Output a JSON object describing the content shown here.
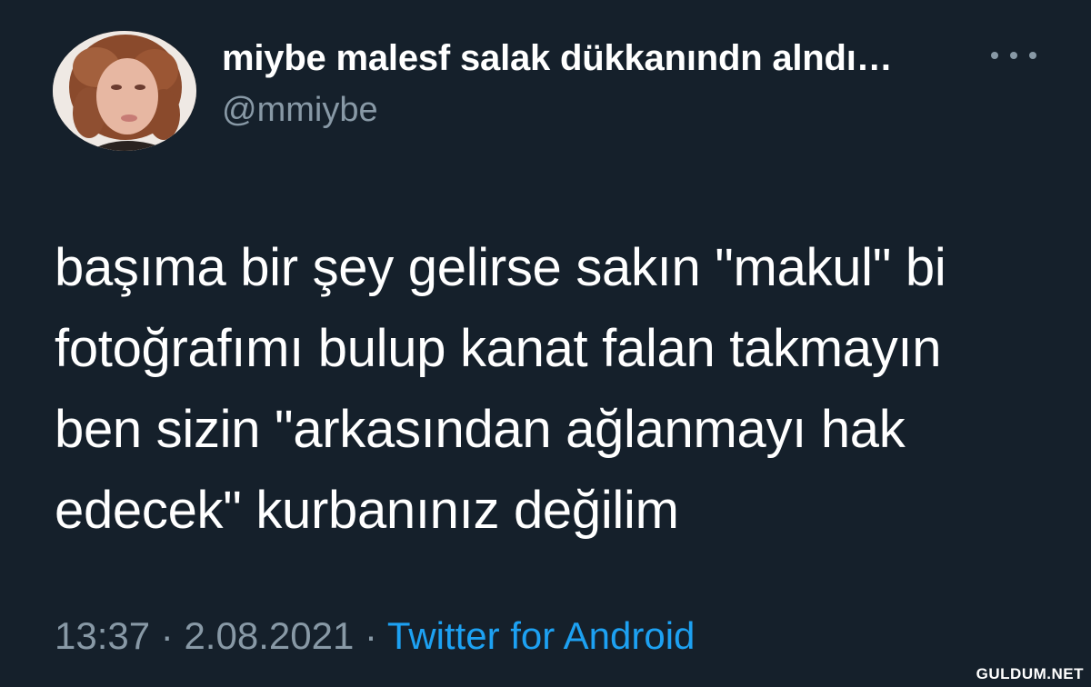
{
  "tweet": {
    "author": {
      "display_name": "miybe malesf salak dükkanındn alndı…",
      "username": "@mmiybe",
      "avatar_icon": "profile-photo"
    },
    "more_icon": "more-horizontal-icon",
    "text_lines": [
      "başıma bir şey gelirse sakın \"makul\" bi",
      "fotoğrafımı bulup kanat falan takmayın",
      "ben sizin \"arkasından ağlanmayı hak",
      "edecek\" kurbanınız değilim"
    ],
    "time": "13:37",
    "separator": "·",
    "date": "2.08.2021",
    "source": "Twitter for Android"
  },
  "watermark": "GULDUM.NET",
  "colors": {
    "background": "#15202b",
    "text": "#ffffff",
    "secondary": "#8899a6",
    "link": "#1da1f2"
  }
}
